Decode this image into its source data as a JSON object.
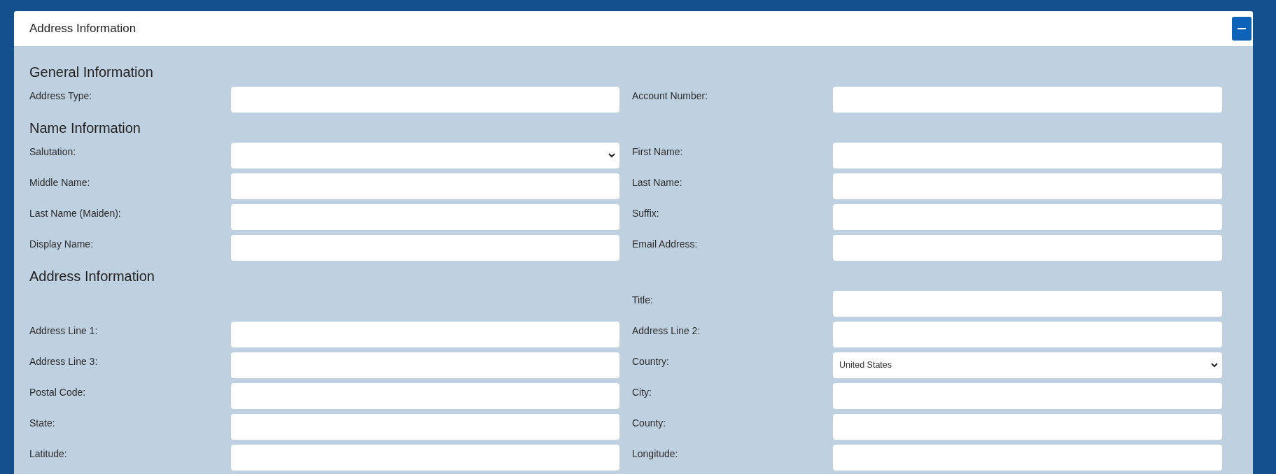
{
  "panel": {
    "title": "Address Information",
    "collapse_button": {
      "expanded": true
    }
  },
  "sections": [
    {
      "heading": "General Information",
      "rows": [
        {
          "left": {
            "label": "Address Type:",
            "kind": "text"
          },
          "right": {
            "label": "Account Number:",
            "kind": "text"
          }
        }
      ]
    },
    {
      "heading": "Name Information",
      "rows": [
        {
          "left": {
            "label": "Salutation:",
            "kind": "select"
          },
          "right": {
            "label": "First Name:",
            "kind": "text"
          }
        },
        {
          "left": {
            "label": "Middle Name:",
            "kind": "text"
          },
          "right": {
            "label": "Last Name:",
            "kind": "text"
          }
        },
        {
          "left": {
            "label": "Last Name (Maiden):",
            "kind": "text"
          },
          "right": {
            "label": "Suffix:",
            "kind": "text"
          }
        },
        {
          "left": {
            "label": "Display Name:",
            "kind": "text"
          },
          "right": {
            "label": "Email Address:",
            "kind": "text"
          }
        }
      ]
    },
    {
      "heading": "Address Information",
      "rows": [
        {
          "right": {
            "label": "Title:",
            "kind": "text"
          }
        },
        {
          "left": {
            "label": "Address Line 1:",
            "kind": "text"
          },
          "right": {
            "label": "Address Line 2:",
            "kind": "text"
          }
        },
        {
          "left": {
            "label": "Address Line 3:",
            "kind": "text"
          },
          "right": {
            "label": "Country:",
            "kind": "select",
            "value": "United States"
          }
        },
        {
          "left": {
            "label": "Postal Code:",
            "kind": "text"
          },
          "right": {
            "label": "City:",
            "kind": "text"
          }
        },
        {
          "left": {
            "label": "State:",
            "kind": "text"
          },
          "right": {
            "label": "County:",
            "kind": "text"
          }
        },
        {
          "left": {
            "label": "Latitude:",
            "kind": "text"
          },
          "right": {
            "label": "Longitude:",
            "kind": "text"
          }
        }
      ]
    }
  ]
}
